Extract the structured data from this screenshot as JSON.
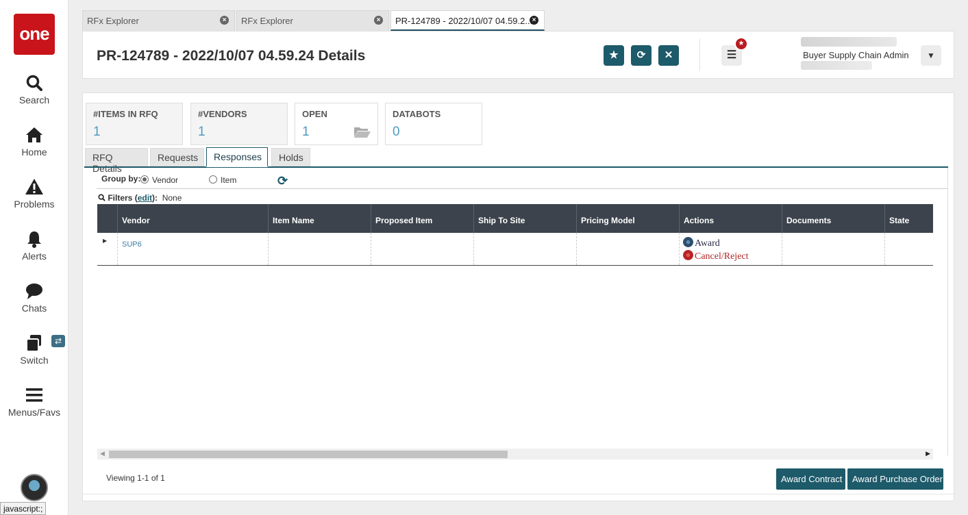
{
  "nav": {
    "logo": "one",
    "items": [
      {
        "label": "Search",
        "icon": "search-icon"
      },
      {
        "label": "Home",
        "icon": "home-icon"
      },
      {
        "label": "Problems",
        "icon": "warning-icon"
      },
      {
        "label": "Alerts",
        "icon": "bell-icon"
      },
      {
        "label": "Chats",
        "icon": "chat-icon"
      },
      {
        "label": "Switch",
        "icon": "switch-icon"
      },
      {
        "label": "Menus/Favs",
        "icon": "hamburger-icon"
      }
    ]
  },
  "status_bar": "javascript:;",
  "tabs": [
    {
      "label": "RFx Explorer",
      "active": false
    },
    {
      "label": "RFx Explorer",
      "active": false
    },
    {
      "label": "PR-124789 - 2022/10/07 04.59.2...",
      "active": true
    }
  ],
  "header": {
    "title": "PR-124789 - 2022/10/07 04.59.24 Details",
    "user_role": "Buyer Supply Chain Admin"
  },
  "kpis": [
    {
      "label": "#ITEMS IN RFQ",
      "value": "1"
    },
    {
      "label": "#VENDORS",
      "value": "1"
    },
    {
      "label": "OPEN",
      "value": "1"
    },
    {
      "label": "DATABOTS",
      "value": "0"
    }
  ],
  "page_tabs": [
    {
      "label": "RFQ Details"
    },
    {
      "label": "Requests"
    },
    {
      "label": "Responses",
      "active": true
    },
    {
      "label": "Holds"
    }
  ],
  "group_by": {
    "label": "Group by:",
    "options": [
      "Vendor",
      "Item"
    ],
    "selected": "Vendor"
  },
  "filters": {
    "label": "Filters",
    "edit": "edit",
    "value": "None"
  },
  "grid": {
    "columns": [
      "Vendor",
      "Item Name",
      "Proposed Item",
      "Ship To Site",
      "Pricing Model",
      "Actions",
      "Documents",
      "State"
    ],
    "rows": [
      {
        "vendor": "SUP6",
        "item_name": "",
        "proposed_item": "",
        "ship_to_site": "",
        "pricing_model": "",
        "actions": [
          "Award",
          "Cancel/Reject"
        ],
        "documents": "",
        "state": ""
      }
    ]
  },
  "footer": {
    "viewing": "Viewing 1-1 of 1",
    "buttons": [
      "Award Contract",
      "Award Purchase Order"
    ]
  },
  "colors": {
    "brand": "#c8141a",
    "accent": "#1d5a6a",
    "grid_header": "#3c434c",
    "link": "#3a7ea3",
    "reject": "#b02626"
  }
}
